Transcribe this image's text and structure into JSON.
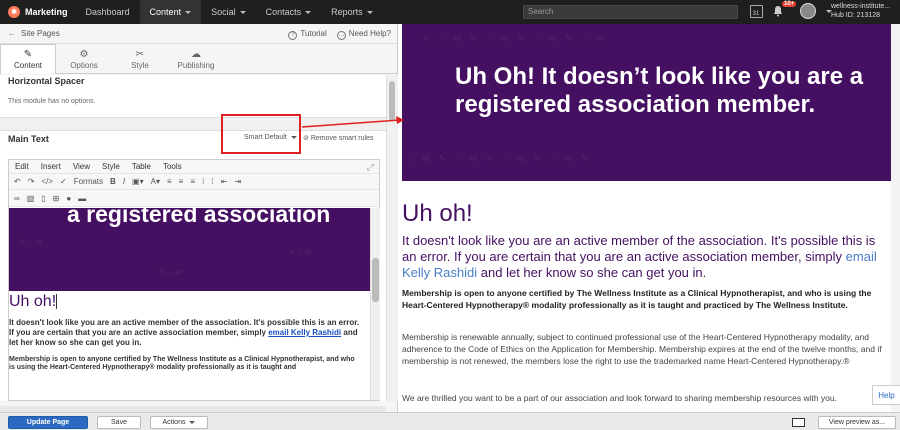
{
  "nav": {
    "brand": "Marketing",
    "items": [
      "Dashboard",
      "Content",
      "Social",
      "Contacts",
      "Reports"
    ],
    "search_placeholder": "Search",
    "calendar_day": "31",
    "notifications": "10+",
    "account_name": "wellness-institute...",
    "hub_id": "Hub ID: 213128"
  },
  "left": {
    "breadcrumb": "Site Pages",
    "tutorial": "Tutorial",
    "need_help": "Need Help?",
    "tabs": [
      {
        "label": "Content",
        "icon": "pencil-icon"
      },
      {
        "label": "Options",
        "icon": "gear-icon"
      },
      {
        "label": "Style",
        "icon": "scissors-icon"
      },
      {
        "label": "Publishing",
        "icon": "cloud-icon"
      }
    ],
    "spacer_title": "Horizontal Spacer",
    "spacer_note": "This module has no options.",
    "main_text_title": "Main Text",
    "smart_default": "Smart Default",
    "remove_rules": "Remove smart rules"
  },
  "editor": {
    "menu": [
      "Edit",
      "Insert",
      "View",
      "Style",
      "Table",
      "Tools"
    ],
    "formats": "Formats",
    "hero_text": "a registered association",
    "heading": "Uh oh!",
    "para1_a": "It doesn't look like you are an active member of the association. It's possible this is an error. If you are certain that you are an active association member, simply ",
    "para1_link": "email Kelly Rashidi",
    "para1_b": " and let her know so she can get you in.",
    "para2": "Membership is open to anyone certified by The Wellness Institute as a Clinical Hypnotherapist, and who is using the Heart-Centered Hypnotherapy® modality professionally as it is taught and"
  },
  "bottom": {
    "update": "Update Page",
    "save": "Save",
    "actions": "Actions",
    "view_preview": "View preview as..."
  },
  "preview": {
    "hero_title": "Uh Oh! It doesn’t look like you are a registered association member.",
    "heading": "Uh oh!",
    "lead_a": "It doesn't look like you are an active member of the association. It's possible this is an error. If you are certain that you are an active association member, simply ",
    "lead_link": "email Kelly Rashidi",
    "lead_b": " and let her know so she can get you in.",
    "bold_para": "Membership is open to anyone certified by The Wellness Institute as a Clinical Hypnotherapist, and who is using the Heart-Centered Hypnotherapy® modality professionally as it is taught and practiced by The Wellness Institute.",
    "para": "Membership is renewable annually, subject to continued professional use of the Heart-Centered Hypnotherapy modality, and adherence to the Code of Ethics on the Application for Membership. Membership expires at the end of the twelve months, and if membership is not renewed, the members lose the right to use the trademarked name Heart-Centered Hypnotherapy.®",
    "para2": "We are thrilled you want to be a part of our association and look forward to sharing membership resources with you.",
    "help": "Help"
  },
  "colors": {
    "brand_purple": "#451061",
    "primary_blue": "#2c6ac2",
    "annotation_red": "#e02020"
  }
}
